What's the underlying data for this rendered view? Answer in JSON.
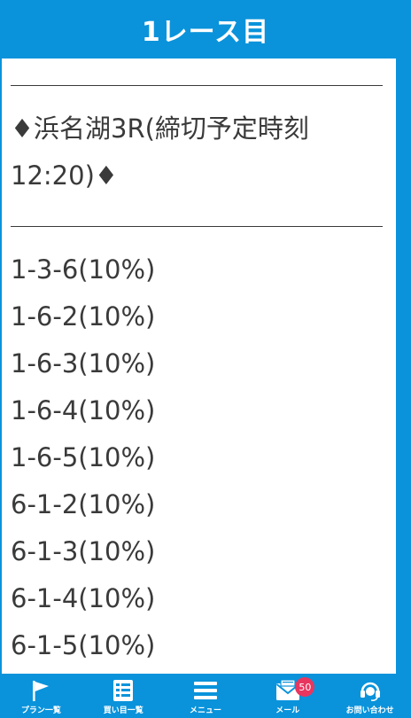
{
  "header": {
    "title": "1レース目"
  },
  "content": {
    "lines": [
      {
        "kind": "rule"
      },
      {
        "kind": "text",
        "text": "♦浜名湖3R(締切予定時刻"
      },
      {
        "kind": "text",
        "text": "12:20)♦"
      },
      {
        "kind": "rule"
      },
      {
        "kind": "text",
        "text": "1-3-6(10%)"
      },
      {
        "kind": "text",
        "text": "1-6-2(10%)"
      },
      {
        "kind": "text",
        "text": "1-6-3(10%)"
      },
      {
        "kind": "text",
        "text": "1-6-4(10%)"
      },
      {
        "kind": "text",
        "text": "1-6-5(10%)"
      },
      {
        "kind": "text",
        "text": "6-1-2(10%)"
      },
      {
        "kind": "text",
        "text": "6-1-3(10%)"
      },
      {
        "kind": "text",
        "text": "6-1-4(10%)"
      },
      {
        "kind": "text",
        "text": "6-1-5(10%)"
      }
    ]
  },
  "nav": {
    "items": [
      {
        "label": "プラン一覧",
        "icon": "flag-icon"
      },
      {
        "label": "買い目一覧",
        "icon": "list-icon"
      },
      {
        "label": "メニュー",
        "icon": "menu-icon"
      },
      {
        "label": "メール",
        "icon": "mail-icon",
        "badge": "50"
      },
      {
        "label": "お問い合わせ",
        "icon": "headset-icon"
      }
    ]
  },
  "colors": {
    "brand": "#0a93db",
    "badge": "#e8365f",
    "text": "#3a3a3a"
  }
}
